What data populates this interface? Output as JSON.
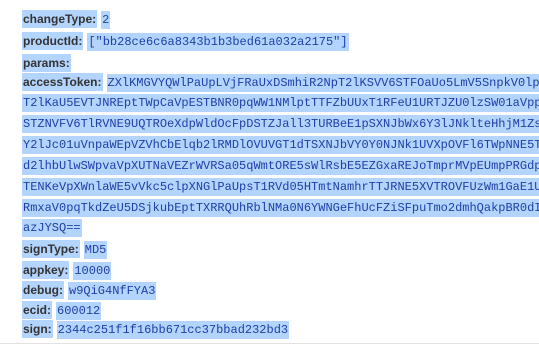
{
  "fields": {
    "changeType": {
      "key": "changeType:",
      "value": "2"
    },
    "productId": {
      "key": "productId:",
      "value": "[\"bb28ce6c6a8343b1b3bed61a032a2175\"]"
    },
    "params": {
      "key": "params:"
    },
    "accessToken": {
      "key": "accessToken:",
      "lines": [
        "ZXlKMGVYQWlPaUpLVjFRaUxDSmhiR2NpT2lKSVV6STFOaUo5LmV5SnpkV0lp",
        "T2lKaU5EVTJNREptTWpCaVpESTBNR0pqWW1NMlptTTFZbUUxT1RFeU1URTJZU0lzSW01aVpp",
        "STZNVFV6TlRVNE9UQTROeXdpWldOcFpDSTZJall3TURBeE1pSXNJbWx6Y3lJNklteHhjM1Zs",
        "Y2lJc01uVnpaWEpVZVhCbElqb2lRMDlOVUVGT1dTSXNJbVY0Y0NJNk1UVXpOVFl6TWpNNE5T",
        "d2lhbUlwSWpvaVpXUTNaVEZrWVRSa05qWmtORE5sWlRsbE5EZGxaREJoTmprMVpEUmpPRGdp",
        "TENKeVpXWnlaWE5vVkc5clpXNGlPaUpsT1RVd05HTmtNamhrTTJRNE5XVTROVFUzWm1GaE1U",
        "RmxaV0pqTkdZeU5DSjkubEptTXRRQUhRblNMa0N6YWNGeFhUcFZiSFpuTmo2dmhQakpBR0dI",
        "azJYSQ=="
      ]
    },
    "signType": {
      "key": "signType:",
      "value": "MD5"
    },
    "appkey": {
      "key": "appkey:",
      "value": "10000"
    },
    "debug": {
      "key": "debug:",
      "value": "w9QiG4NfFYA3"
    },
    "ecid": {
      "key": "ecid:",
      "value": "600012"
    },
    "sign": {
      "key": "sign:",
      "value": "2344c251f1f16bb671cc37bbad232bd3"
    }
  },
  "colors": {
    "selection": "#b3d4fd",
    "key_text": "#333333",
    "value_text": "#1f40a8"
  }
}
